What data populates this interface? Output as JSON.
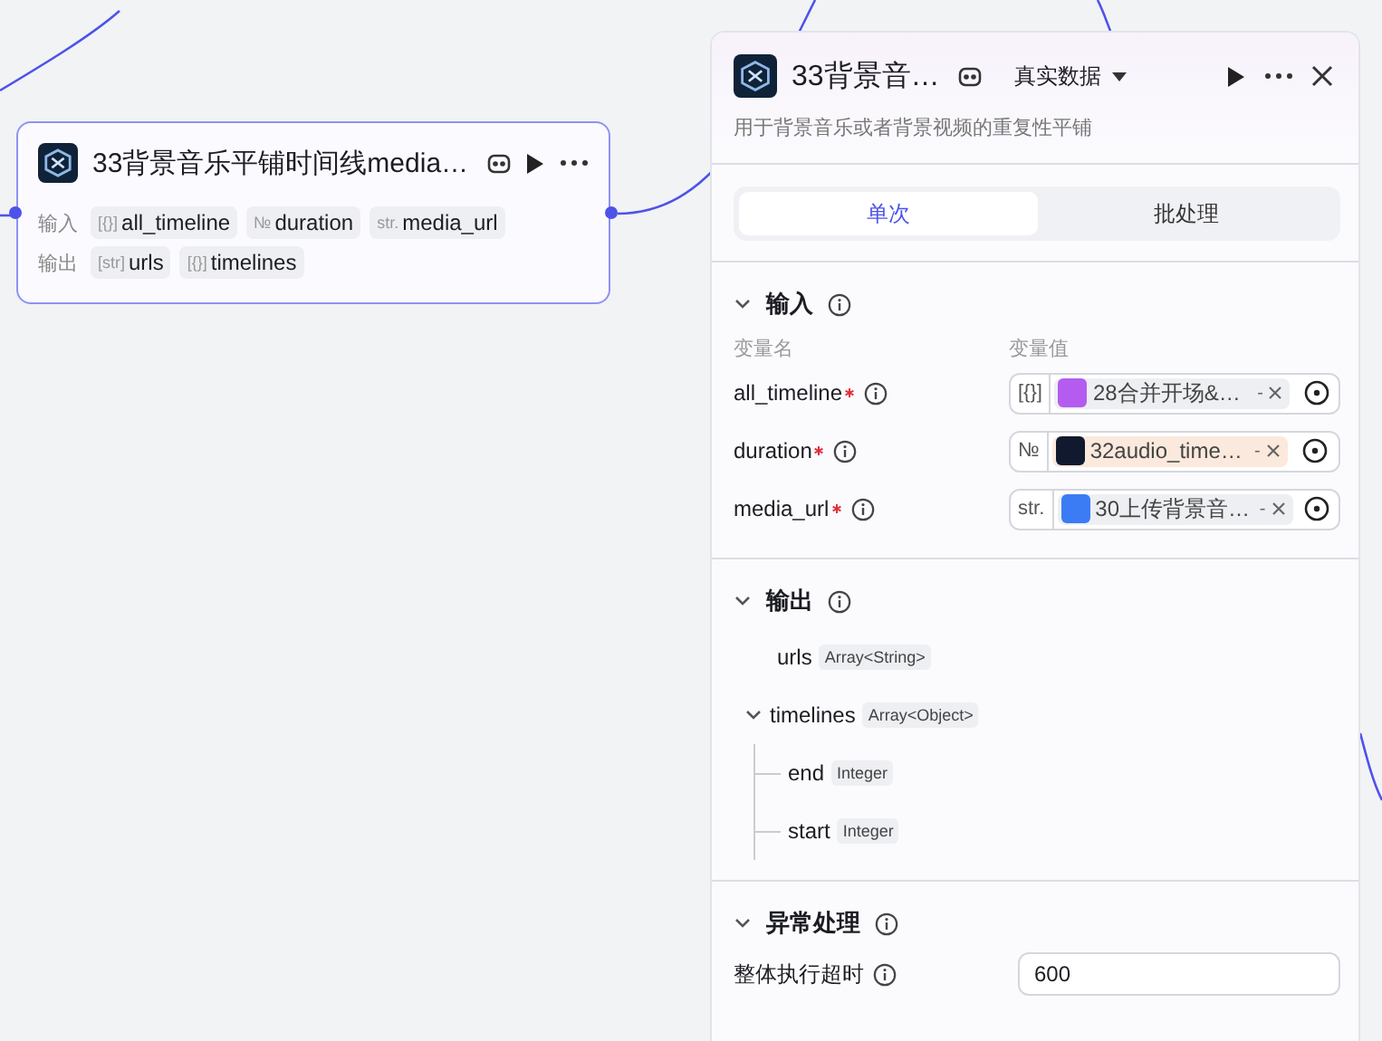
{
  "node": {
    "title": "33背景音乐平铺时间线media…",
    "rows": [
      {
        "label": "输入",
        "params": [
          {
            "type": "[{}]",
            "name": "all_timeline"
          },
          {
            "type": "№",
            "name": "duration"
          },
          {
            "type": "str.",
            "name": "media_url"
          }
        ]
      },
      {
        "label": "输出",
        "params": [
          {
            "type": "[str]",
            "name": "urls"
          },
          {
            "type": "[{}]",
            "name": "timelines"
          }
        ]
      }
    ]
  },
  "panel": {
    "title": "33背景音…",
    "data_source": "真实数据",
    "description": "用于背景音乐或者背景视频的重复性平铺",
    "tabs": [
      {
        "label": "单次",
        "selected": true
      },
      {
        "label": "批处理",
        "selected": false
      }
    ],
    "inputs": {
      "title": "输入",
      "expanded": true,
      "columns": [
        "变量名",
        "变量值"
      ],
      "rows": [
        {
          "name": "all_timeline",
          "required": true,
          "type": "[{}]",
          "ref": "28合并开场&…",
          "suffix": "-",
          "color": "#b45cf0",
          "highlighted": false
        },
        {
          "name": "duration",
          "required": true,
          "type": "№",
          "ref": "32audio_time…",
          "suffix": "-",
          "color": "#10192e",
          "highlighted": true
        },
        {
          "name": "media_url",
          "required": true,
          "type": "str.",
          "ref": "30上传背景音…",
          "suffix": "-",
          "color": "#3b7cf5",
          "highlighted": false
        }
      ]
    },
    "outputs": {
      "title": "输出",
      "expanded": true,
      "items": [
        {
          "name": "urls",
          "type": "Array<String>"
        },
        {
          "name": "timelines",
          "type": "Array<Object>",
          "expanded": true,
          "children": [
            {
              "name": "end",
              "type": "Integer"
            },
            {
              "name": "start",
              "type": "Integer"
            }
          ]
        }
      ]
    },
    "exception": {
      "title": "异常处理",
      "expanded": true,
      "field_label": "整体执行超时",
      "value": "600"
    }
  }
}
